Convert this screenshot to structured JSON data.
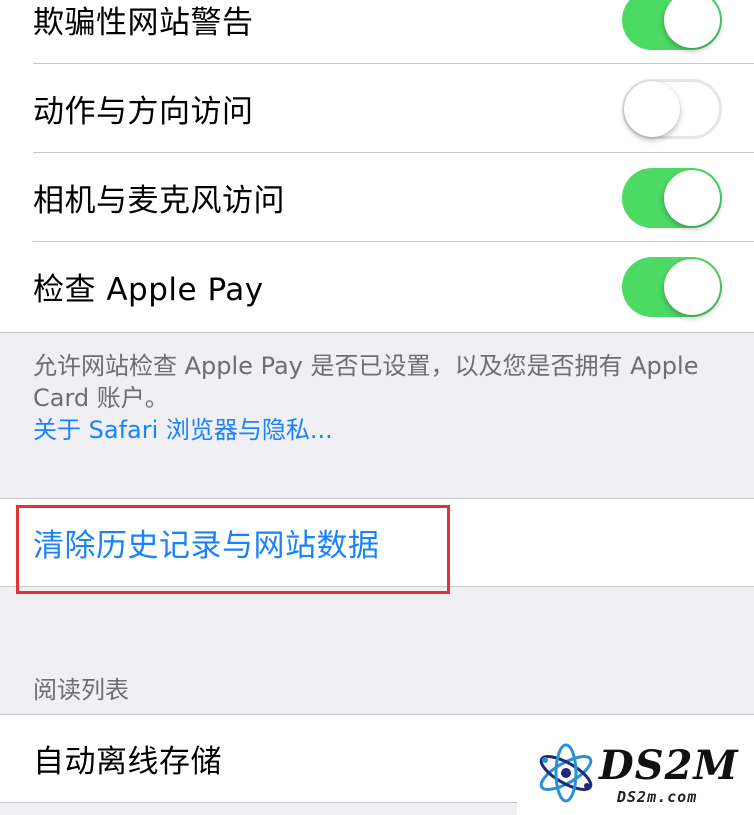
{
  "privacy_settings": {
    "rows": [
      {
        "label": "欺骗性网站警告",
        "toggle": "on"
      },
      {
        "label": "动作与方向访问",
        "toggle": "off"
      },
      {
        "label": "相机与麦克风访问",
        "toggle": "on"
      },
      {
        "label": "检查 Apple Pay",
        "toggle": "on"
      }
    ],
    "footer_text": "允许网站检查 Apple Pay 是否已设置，以及您是否拥有 Apple Card 账户。",
    "footer_link": "关于 Safari 浏览器与隐私..."
  },
  "clear_history": {
    "label": "清除历史记录与网站数据"
  },
  "reading_list": {
    "header": "阅读列表",
    "rows": [
      {
        "label": "自动离线存储",
        "toggle": "off"
      }
    ]
  },
  "watermark": {
    "brand": "DS2M",
    "domain": "DS2m.com"
  },
  "colors": {
    "toggle_on": "#4cd964",
    "link_blue": "#1a82fb",
    "highlight_red": "#e0343a",
    "grouped_background": "#efeff4"
  }
}
